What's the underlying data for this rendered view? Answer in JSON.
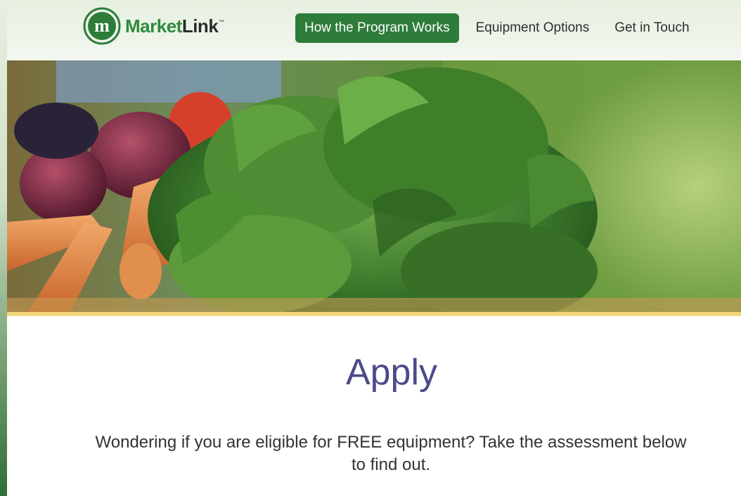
{
  "brand": {
    "logo_text_market": "Market",
    "logo_text_link": "Link",
    "logo_tm": "™",
    "logo_mark_letter": "m"
  },
  "nav": {
    "items": [
      {
        "label": "How the Program Works",
        "active": true
      },
      {
        "label": "Equipment Options",
        "active": false
      },
      {
        "label": "Get in Touch",
        "active": false
      }
    ]
  },
  "hero": {
    "image": "produce-photo"
  },
  "main": {
    "title": "Apply",
    "intro": "Wondering if you are eligible for FREE equipment? Take the assessment below to find out."
  },
  "colors": {
    "accent_green": "#2d7c3a",
    "title_purple": "#4b4b8a",
    "hero_bar_yellow": "#f2d77a"
  }
}
